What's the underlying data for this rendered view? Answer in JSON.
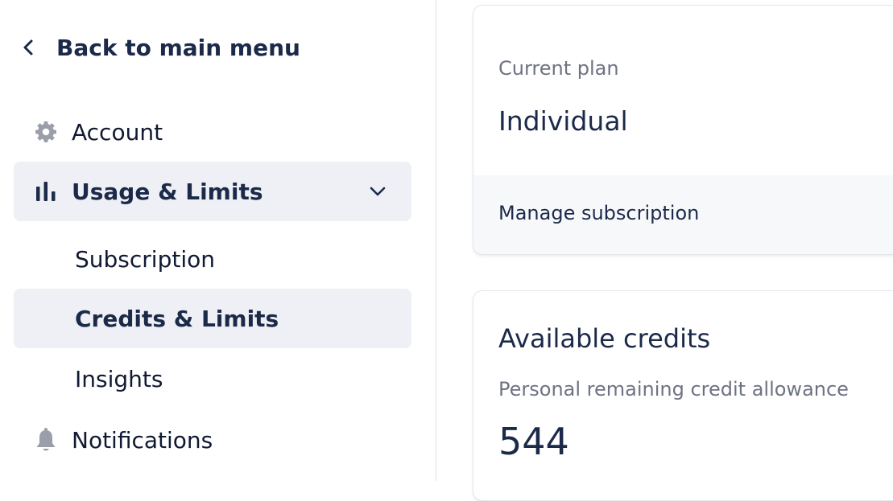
{
  "sidebar": {
    "back_label": "Back to main menu",
    "items": [
      {
        "label": "Account",
        "icon": "gear-icon"
      },
      {
        "label": "Usage & Limits",
        "icon": "bar-chart-icon",
        "expanded": true
      },
      {
        "label": "Notifications",
        "icon": "bell-icon"
      }
    ],
    "subitems": [
      {
        "label": "Subscription"
      },
      {
        "label": "Credits & Limits",
        "selected": true
      },
      {
        "label": "Insights"
      }
    ]
  },
  "plan_card": {
    "label": "Current plan",
    "plan_name": "Individual",
    "manage_link": "Manage subscription"
  },
  "credits_card": {
    "title": "Available credits",
    "subtitle": "Personal remaining credit allowance",
    "value": "544"
  },
  "colors": {
    "active_bg": "#eff0f5",
    "text_dark": "#1c2a4a",
    "text_muted": "#6e7383",
    "icon_gray": "#9a9ea8"
  }
}
